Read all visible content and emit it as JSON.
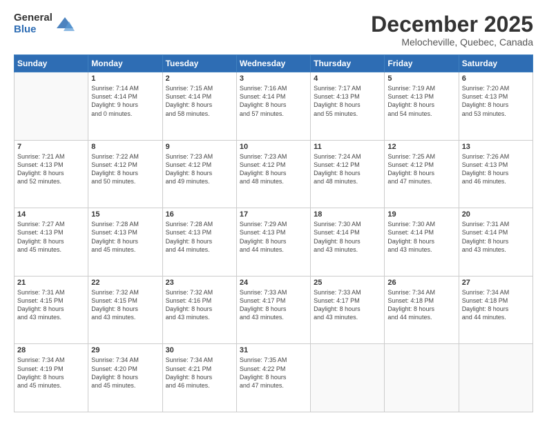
{
  "logo": {
    "general": "General",
    "blue": "Blue"
  },
  "header": {
    "month": "December 2025",
    "location": "Melocheville, Quebec, Canada"
  },
  "weekdays": [
    "Sunday",
    "Monday",
    "Tuesday",
    "Wednesday",
    "Thursday",
    "Friday",
    "Saturday"
  ],
  "weeks": [
    [
      {
        "day": "",
        "info": ""
      },
      {
        "day": "1",
        "info": "Sunrise: 7:14 AM\nSunset: 4:14 PM\nDaylight: 9 hours\nand 0 minutes."
      },
      {
        "day": "2",
        "info": "Sunrise: 7:15 AM\nSunset: 4:14 PM\nDaylight: 8 hours\nand 58 minutes."
      },
      {
        "day": "3",
        "info": "Sunrise: 7:16 AM\nSunset: 4:14 PM\nDaylight: 8 hours\nand 57 minutes."
      },
      {
        "day": "4",
        "info": "Sunrise: 7:17 AM\nSunset: 4:13 PM\nDaylight: 8 hours\nand 55 minutes."
      },
      {
        "day": "5",
        "info": "Sunrise: 7:19 AM\nSunset: 4:13 PM\nDaylight: 8 hours\nand 54 minutes."
      },
      {
        "day": "6",
        "info": "Sunrise: 7:20 AM\nSunset: 4:13 PM\nDaylight: 8 hours\nand 53 minutes."
      }
    ],
    [
      {
        "day": "7",
        "info": "Sunrise: 7:21 AM\nSunset: 4:13 PM\nDaylight: 8 hours\nand 52 minutes."
      },
      {
        "day": "8",
        "info": "Sunrise: 7:22 AM\nSunset: 4:12 PM\nDaylight: 8 hours\nand 50 minutes."
      },
      {
        "day": "9",
        "info": "Sunrise: 7:23 AM\nSunset: 4:12 PM\nDaylight: 8 hours\nand 49 minutes."
      },
      {
        "day": "10",
        "info": "Sunrise: 7:23 AM\nSunset: 4:12 PM\nDaylight: 8 hours\nand 48 minutes."
      },
      {
        "day": "11",
        "info": "Sunrise: 7:24 AM\nSunset: 4:12 PM\nDaylight: 8 hours\nand 48 minutes."
      },
      {
        "day": "12",
        "info": "Sunrise: 7:25 AM\nSunset: 4:12 PM\nDaylight: 8 hours\nand 47 minutes."
      },
      {
        "day": "13",
        "info": "Sunrise: 7:26 AM\nSunset: 4:13 PM\nDaylight: 8 hours\nand 46 minutes."
      }
    ],
    [
      {
        "day": "14",
        "info": "Sunrise: 7:27 AM\nSunset: 4:13 PM\nDaylight: 8 hours\nand 45 minutes."
      },
      {
        "day": "15",
        "info": "Sunrise: 7:28 AM\nSunset: 4:13 PM\nDaylight: 8 hours\nand 45 minutes."
      },
      {
        "day": "16",
        "info": "Sunrise: 7:28 AM\nSunset: 4:13 PM\nDaylight: 8 hours\nand 44 minutes."
      },
      {
        "day": "17",
        "info": "Sunrise: 7:29 AM\nSunset: 4:13 PM\nDaylight: 8 hours\nand 44 minutes."
      },
      {
        "day": "18",
        "info": "Sunrise: 7:30 AM\nSunset: 4:14 PM\nDaylight: 8 hours\nand 43 minutes."
      },
      {
        "day": "19",
        "info": "Sunrise: 7:30 AM\nSunset: 4:14 PM\nDaylight: 8 hours\nand 43 minutes."
      },
      {
        "day": "20",
        "info": "Sunrise: 7:31 AM\nSunset: 4:14 PM\nDaylight: 8 hours\nand 43 minutes."
      }
    ],
    [
      {
        "day": "21",
        "info": "Sunrise: 7:31 AM\nSunset: 4:15 PM\nDaylight: 8 hours\nand 43 minutes."
      },
      {
        "day": "22",
        "info": "Sunrise: 7:32 AM\nSunset: 4:15 PM\nDaylight: 8 hours\nand 43 minutes."
      },
      {
        "day": "23",
        "info": "Sunrise: 7:32 AM\nSunset: 4:16 PM\nDaylight: 8 hours\nand 43 minutes."
      },
      {
        "day": "24",
        "info": "Sunrise: 7:33 AM\nSunset: 4:17 PM\nDaylight: 8 hours\nand 43 minutes."
      },
      {
        "day": "25",
        "info": "Sunrise: 7:33 AM\nSunset: 4:17 PM\nDaylight: 8 hours\nand 43 minutes."
      },
      {
        "day": "26",
        "info": "Sunrise: 7:34 AM\nSunset: 4:18 PM\nDaylight: 8 hours\nand 44 minutes."
      },
      {
        "day": "27",
        "info": "Sunrise: 7:34 AM\nSunset: 4:18 PM\nDaylight: 8 hours\nand 44 minutes."
      }
    ],
    [
      {
        "day": "28",
        "info": "Sunrise: 7:34 AM\nSunset: 4:19 PM\nDaylight: 8 hours\nand 45 minutes."
      },
      {
        "day": "29",
        "info": "Sunrise: 7:34 AM\nSunset: 4:20 PM\nDaylight: 8 hours\nand 45 minutes."
      },
      {
        "day": "30",
        "info": "Sunrise: 7:34 AM\nSunset: 4:21 PM\nDaylight: 8 hours\nand 46 minutes."
      },
      {
        "day": "31",
        "info": "Sunrise: 7:35 AM\nSunset: 4:22 PM\nDaylight: 8 hours\nand 47 minutes."
      },
      {
        "day": "",
        "info": ""
      },
      {
        "day": "",
        "info": ""
      },
      {
        "day": "",
        "info": ""
      }
    ]
  ]
}
